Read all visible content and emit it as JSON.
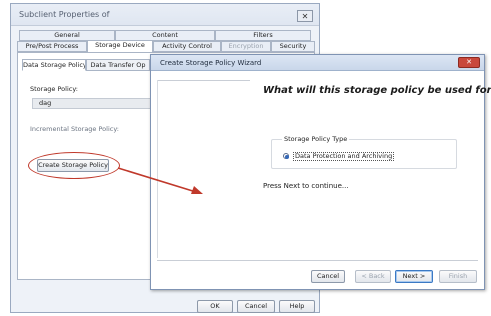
{
  "background_dialog": {
    "title": "Subclient Properties of",
    "close_label": "✕",
    "tabs_row1": [
      "General",
      "Content",
      "Filters"
    ],
    "tabs_row2": [
      "Pre/Post Process",
      "Storage Device",
      "Activity Control",
      "Encryption",
      "Security"
    ],
    "subtabs": [
      "Data Storage Policy",
      "Data Transfer Op"
    ],
    "storage_policy_label": "Storage Policy:",
    "storage_policy_value": "dag",
    "incremental_label": "Incremental Storage Policy:",
    "create_button": "Create Storage Policy",
    "ok_button": "OK",
    "cancel_button": "Cancel",
    "help_button": "Help"
  },
  "wizard": {
    "title": "Create Storage Policy Wizard",
    "close_label": "✕",
    "heading": "What will this storage policy be used for?",
    "group_title": "Storage Policy Type",
    "radio_label": "Data Protection and Archiving",
    "hint": "Press Next to continue...",
    "buttons": {
      "cancel": "Cancel",
      "back": "< Back",
      "next": "Next >",
      "finish": "Finish"
    }
  },
  "colors": {
    "annotation_red": "#c0392b",
    "wizard_close": "#c9483c",
    "titlebar": "#c9d7ea"
  }
}
